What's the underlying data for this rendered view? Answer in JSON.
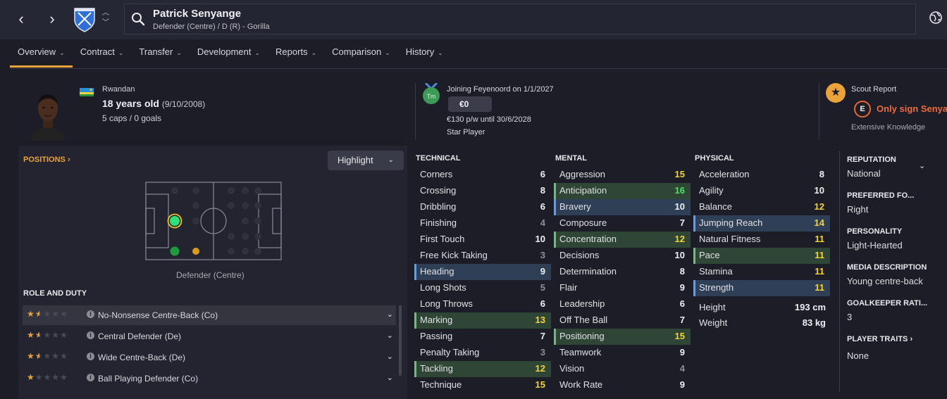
{
  "header": {
    "player_name": "Patrick Senyange",
    "player_sub": "Defender (Centre) / D (R) - Gorilla"
  },
  "tabs": [
    {
      "label": "Overview"
    },
    {
      "label": "Contract"
    },
    {
      "label": "Transfer"
    },
    {
      "label": "Development"
    },
    {
      "label": "Reports"
    },
    {
      "label": "Comparison"
    },
    {
      "label": "History"
    }
  ],
  "bio": {
    "nationality": "Rwandan",
    "age": "18 years old",
    "dob": "(9/10/2008)",
    "caps": "5 caps / 0 goals"
  },
  "transfer": {
    "medal_text": "Tm",
    "joining": "Joining Feyenoord on 1/1/2027",
    "fee": "€0",
    "wage": "€130 p/w until 30/6/2028",
    "status": "Star Player"
  },
  "scout": {
    "title": "Scout Report",
    "grade": "E",
    "recommendation": "Only sign Senyange",
    "knowledge": "Extensive Knowledge"
  },
  "positions": {
    "title": "POSITIONS",
    "highlight_label": "Highlight",
    "position_label": "Defender (Centre)"
  },
  "roles": {
    "title": "ROLE AND DUTY",
    "items": [
      {
        "name": "No-Nonsense Centre-Back (Co)",
        "stars": 1.5
      },
      {
        "name": "Central Defender (De)",
        "stars": 1.5
      },
      {
        "name": "Wide Centre-Back (De)",
        "stars": 1.5
      },
      {
        "name": "Ball Playing Defender (Co)",
        "stars": 1
      }
    ]
  },
  "attributes": {
    "technical": {
      "title": "TECHNICAL",
      "rows": [
        {
          "name": "Corners",
          "value": "6",
          "hl": "",
          "color": "white"
        },
        {
          "name": "Crossing",
          "value": "8",
          "hl": "",
          "color": "white"
        },
        {
          "name": "Dribbling",
          "value": "6",
          "hl": "",
          "color": "white"
        },
        {
          "name": "Finishing",
          "value": "4",
          "hl": "",
          "color": "grey"
        },
        {
          "name": "First Touch",
          "value": "10",
          "hl": "",
          "color": "white"
        },
        {
          "name": "Free Kick Taking",
          "value": "3",
          "hl": "",
          "color": "grey"
        },
        {
          "name": "Heading",
          "value": "9",
          "hl": "blue",
          "color": "white"
        },
        {
          "name": "Long Shots",
          "value": "5",
          "hl": "",
          "color": "grey"
        },
        {
          "name": "Long Throws",
          "value": "6",
          "hl": "",
          "color": "white"
        },
        {
          "name": "Marking",
          "value": "13",
          "hl": "green",
          "color": "yellow"
        },
        {
          "name": "Passing",
          "value": "7",
          "hl": "",
          "color": "white"
        },
        {
          "name": "Penalty Taking",
          "value": "3",
          "hl": "",
          "color": "grey"
        },
        {
          "name": "Tackling",
          "value": "12",
          "hl": "green",
          "color": "yellow"
        },
        {
          "name": "Technique",
          "value": "15",
          "hl": "",
          "color": "yellow"
        }
      ]
    },
    "mental": {
      "title": "MENTAL",
      "rows": [
        {
          "name": "Aggression",
          "value": "15",
          "hl": "",
          "color": "yellow"
        },
        {
          "name": "Anticipation",
          "value": "16",
          "hl": "green",
          "color": "green"
        },
        {
          "name": "Bravery",
          "value": "10",
          "hl": "blue",
          "color": "white"
        },
        {
          "name": "Composure",
          "value": "7",
          "hl": "",
          "color": "white"
        },
        {
          "name": "Concentration",
          "value": "12",
          "hl": "green",
          "color": "yellow"
        },
        {
          "name": "Decisions",
          "value": "10",
          "hl": "",
          "color": "white"
        },
        {
          "name": "Determination",
          "value": "8",
          "hl": "",
          "color": "white"
        },
        {
          "name": "Flair",
          "value": "9",
          "hl": "",
          "color": "white"
        },
        {
          "name": "Leadership",
          "value": "6",
          "hl": "",
          "color": "white"
        },
        {
          "name": "Off The Ball",
          "value": "7",
          "hl": "",
          "color": "white"
        },
        {
          "name": "Positioning",
          "value": "15",
          "hl": "green",
          "color": "yellow"
        },
        {
          "name": "Teamwork",
          "value": "9",
          "hl": "",
          "color": "white"
        },
        {
          "name": "Vision",
          "value": "4",
          "hl": "",
          "color": "grey"
        },
        {
          "name": "Work Rate",
          "value": "9",
          "hl": "",
          "color": "white"
        }
      ]
    },
    "physical": {
      "title": "PHYSICAL",
      "rows": [
        {
          "name": "Acceleration",
          "value": "8",
          "hl": "",
          "color": "white"
        },
        {
          "name": "Agility",
          "value": "10",
          "hl": "",
          "color": "white"
        },
        {
          "name": "Balance",
          "value": "12",
          "hl": "",
          "color": "yellow"
        },
        {
          "name": "Jumping Reach",
          "value": "14",
          "hl": "blue",
          "color": "yellow"
        },
        {
          "name": "Natural Fitness",
          "value": "11",
          "hl": "",
          "color": "yellow"
        },
        {
          "name": "Pace",
          "value": "11",
          "hl": "green",
          "color": "yellow"
        },
        {
          "name": "Stamina",
          "value": "11",
          "hl": "",
          "color": "yellow"
        },
        {
          "name": "Strength",
          "value": "11",
          "hl": "blue",
          "color": "yellow"
        }
      ],
      "height_label": "Height",
      "height": "193 cm",
      "weight_label": "Weight",
      "weight": "83 kg"
    }
  },
  "info": {
    "reputation_label": "REPUTATION",
    "reputation": "National",
    "preferred_foot_label": "PREFERRED FO...",
    "preferred_foot": "Right",
    "personality_label": "PERSONALITY",
    "personality": "Light-Hearted",
    "media_label": "MEDIA DESCRIPTION",
    "media": "Young centre-back",
    "gk_label": "GOALKEEPER RATI...",
    "gk": "3",
    "traits_label": "PLAYER TRAITS",
    "traits": "None"
  },
  "colors": {
    "accent": "#e9a33a",
    "scout_rec": "#ef6a3c",
    "highlight_green": "#2f4535",
    "highlight_blue": "#2f3f55",
    "value_yellow": "#f2d43a",
    "value_green": "#4fe06a"
  }
}
